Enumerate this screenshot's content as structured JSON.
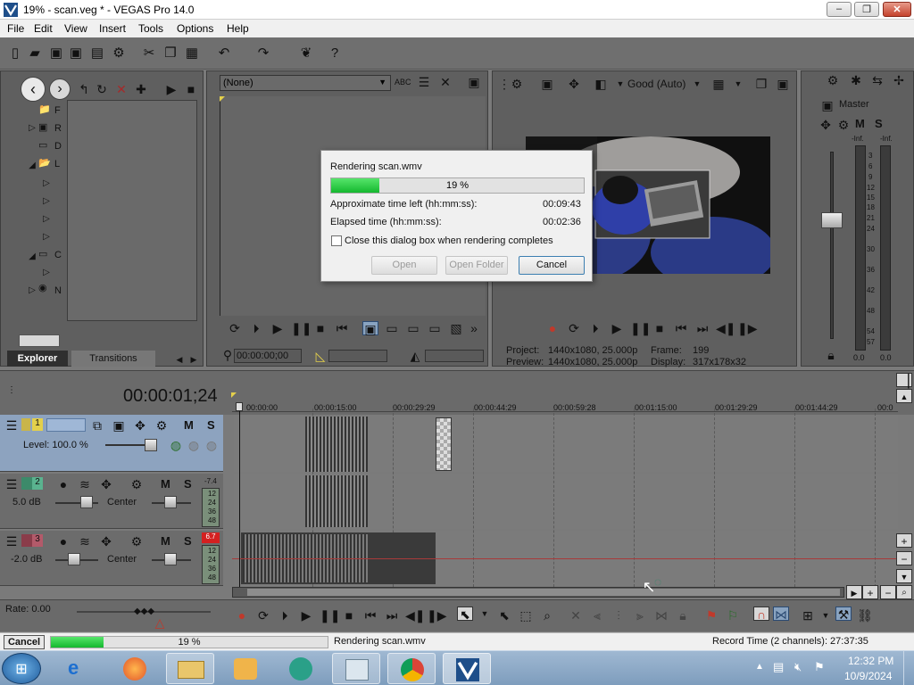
{
  "window": {
    "title": "19% - scan.veg * - VEGAS Pro 14.0",
    "minimize": "–",
    "maximize": "❐",
    "close": "✕"
  },
  "menu": [
    "File",
    "Edit",
    "View",
    "Insert",
    "Tools",
    "Options",
    "Help"
  ],
  "explorer": {
    "tree": [
      "F",
      "R",
      "D",
      "L",
      "C",
      "N"
    ],
    "tabs": {
      "explorer": "Explorer",
      "transitions": "Transitions"
    }
  },
  "trimmer": {
    "selector": "(None)",
    "timecode": "00:00:00;00"
  },
  "preview": {
    "quality": "Good (Auto)",
    "project_label": "Project:",
    "project_value": "1440x1080, 25.000p",
    "preview_label": "Preview:",
    "preview_value": "1440x1080, 25.000p",
    "frame_label": "Frame:",
    "frame_value": "199",
    "display_label": "Display:",
    "display_value": "317x178x32"
  },
  "master": {
    "title": "Master",
    "m": "M",
    "s": "S",
    "inf_left": "-Inf.",
    "inf_right": "-Inf.",
    "scale": [
      "3",
      "6",
      "9",
      "12",
      "15",
      "18",
      "21",
      "24",
      "30",
      "36",
      "42",
      "48",
      "54",
      "57"
    ],
    "readout_left": "0.0",
    "readout_right": "0.0"
  },
  "timeline": {
    "cursor": "00:00:01;24",
    "ruler": [
      "00:00:00",
      "00:00:15:00",
      "00:00:29:29",
      "00:00:44:29",
      "00:00:59:28",
      "00:01:15:00",
      "00:01:29:29",
      "00:01:44:29",
      "00:0"
    ],
    "tracks": [
      {
        "num": "1",
        "label": "Level: 100.0 %",
        "m": "M",
        "s": "S"
      },
      {
        "num": "2",
        "label": "5.0 dB",
        "pan": "Center",
        "m": "M",
        "s": "S",
        "peak": "-7.4",
        "scale": [
          "12",
          "24",
          "36",
          "48"
        ]
      },
      {
        "num": "3",
        "label": "-2.0 dB",
        "pan": "Center",
        "m": "M",
        "s": "S",
        "peak": "6.7",
        "scale": [
          "12",
          "24",
          "36",
          "48"
        ]
      }
    ],
    "rate": "Rate: 0.00"
  },
  "status": {
    "cancel": "Cancel",
    "progress_text": "19 %",
    "progress_value": 0.19,
    "message": "Rendering scan.wmv",
    "record_time": "Record Time (2 channels): 27:37:35"
  },
  "dialog": {
    "title": "Rendering scan.wmv",
    "progress_text": "19 %",
    "progress_value": 0.19,
    "time_left_label": "Approximate time left (hh:mm:ss):",
    "time_left_value": "00:09:43",
    "elapsed_label": "Elapsed time (hh:mm:ss):",
    "elapsed_value": "00:02:36",
    "close_checkbox": "Close this dialog box when rendering completes",
    "open": "Open",
    "open_folder": "Open Folder",
    "cancel": "Cancel"
  },
  "taskbar": {
    "time": "12:32 PM",
    "date": "10/9/2024"
  },
  "colors": {
    "accent_green": "#15b82f",
    "track_selected": "#8da3bf",
    "record_red": "#c0392b"
  }
}
